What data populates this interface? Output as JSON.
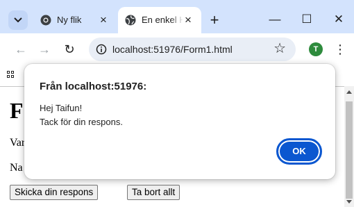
{
  "browser": {
    "tabs": [
      {
        "title": "Ny flik",
        "active": false
      },
      {
        "title": "En enkel H",
        "active": true
      }
    ],
    "new_tab_symbol": "+",
    "window_controls": {
      "minimize": "—",
      "maximize": "☐",
      "close": "✕"
    },
    "url": "localhost:51976/Form1.html",
    "profile_initial": "T",
    "accent_color": "#0b57d0",
    "tabstrip_color": "#d3e3fd"
  },
  "page": {
    "heading_partial": "F",
    "line1_partial": "Var",
    "line2_partial": "Na",
    "submit_button": "Skicka din respons",
    "clear_button": "Ta bort allt"
  },
  "dialog": {
    "title": "Från localhost:51976:",
    "message_line1": "Hej Taifun!",
    "message_line2": "Tack för din respons.",
    "ok_label": "OK"
  },
  "icons": {
    "tab_search": "chevron-down-icon",
    "inactive_tab_favicon": "chrome-icon",
    "active_tab_favicon": "globe-icon",
    "site_info": "info-icon",
    "bookmark": "star-icon",
    "menu": "kebab-menu-icon",
    "apps": "apps-grid-icon"
  }
}
